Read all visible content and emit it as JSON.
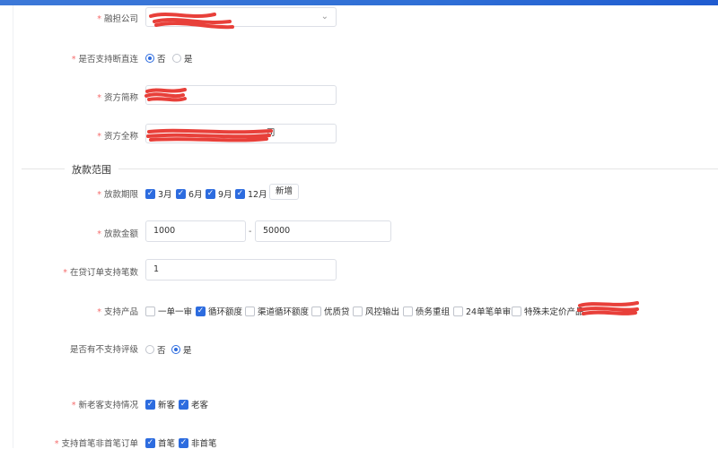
{
  "form": {
    "guarantor_label": "融担公司",
    "guarantor_value": "",
    "direct_label": "是否支持断直连",
    "direct_options": [
      "否",
      "是"
    ],
    "direct_selected": "否",
    "short_name_label": "资方简称",
    "short_name_value": "",
    "full_name_label": "资方全称",
    "full_name_suffix": "司",
    "section_title": "放款范围",
    "term_label": "放款期限",
    "terms": [
      "3月",
      "6月",
      "9月",
      "12月"
    ],
    "add_button": "新增",
    "amount_label": "放款金额",
    "amount_min": "1000",
    "amount_sep": "-",
    "amount_max": "50000",
    "orders_label": "在贷订单支持笔数",
    "orders_value": "1",
    "products_label": "支持产品",
    "products": [
      {
        "name": "一单一审",
        "checked": false
      },
      {
        "name": "循环额度",
        "checked": true
      },
      {
        "name": "渠道循环额度",
        "checked": false
      },
      {
        "name": "优质贷",
        "checked": false
      },
      {
        "name": "风控输出",
        "checked": false
      },
      {
        "name": "债务重组",
        "checked": false
      },
      {
        "name": "24单笔单审",
        "checked": false
      },
      {
        "name": "特殊未定价产品",
        "checked": false
      }
    ],
    "rating_label": "是否有不支持评级",
    "rating_options": [
      "否",
      "是"
    ],
    "rating_selected": "是",
    "customer_label": "新老客支持情况",
    "customers": [
      "新客",
      "老客"
    ],
    "first_order_label": "支持首笔非首笔订单",
    "first_orders": [
      "首笔",
      "非首笔"
    ]
  },
  "colors": {
    "accent": "#2d6cdf",
    "required": "#f56c6c",
    "redaction": "#e8403a"
  }
}
